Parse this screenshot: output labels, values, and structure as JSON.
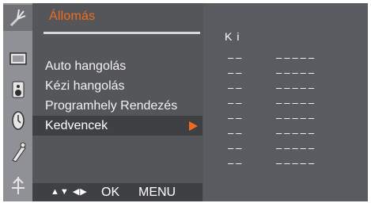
{
  "menu": {
    "title": "Állomás",
    "items": [
      {
        "label": "Auto hangolás"
      },
      {
        "label": "Kézi hangolás"
      },
      {
        "label": "Programhely Rendezés"
      },
      {
        "label": "Kedvencek"
      }
    ],
    "selected_index": 3
  },
  "footer": {
    "nav_glyphs": "▲▼ ◀▶",
    "ok_label": "OK",
    "menu_label": "MENU"
  },
  "status": {
    "value": "Ki",
    "slots": [
      {
        "a": "——",
        "b": "—————"
      },
      {
        "a": "——",
        "b": "—————"
      },
      {
        "a": "——",
        "b": "—————"
      },
      {
        "a": "——",
        "b": "—————"
      },
      {
        "a": "——",
        "b": "—————"
      },
      {
        "a": "——",
        "b": "—————"
      },
      {
        "a": "——",
        "b": "—————"
      },
      {
        "a": "——",
        "b": "—————"
      }
    ]
  },
  "icons": [
    "antenna-icon",
    "picture-icon",
    "sound-icon",
    "clock-icon",
    "option-icon",
    "input-icon"
  ],
  "colors": {
    "accent": "#f26b1d",
    "panel": "#55565a",
    "rail": "#8f9196"
  }
}
